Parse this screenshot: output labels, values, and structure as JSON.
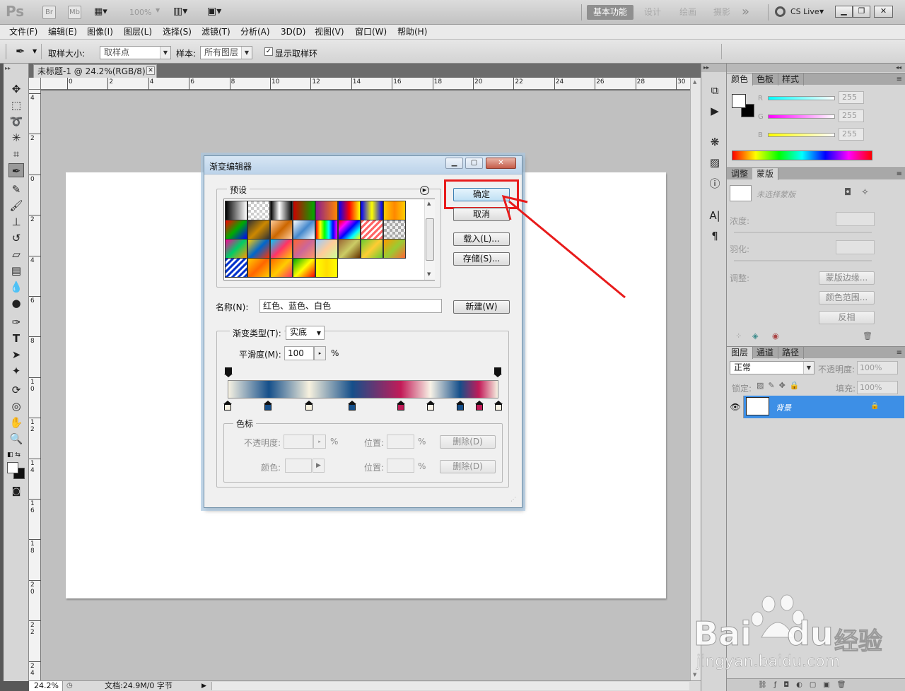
{
  "app": {
    "logo": "Ps",
    "br": "Br",
    "mb": "Mb",
    "zoom": "100%",
    "workspaces": [
      "基本功能",
      "设计",
      "绘画",
      "摄影"
    ],
    "more": "»",
    "cslive": "CS Live"
  },
  "menus": [
    "文件(F)",
    "编辑(E)",
    "图像(I)",
    "图层(L)",
    "选择(S)",
    "滤镜(T)",
    "分析(A)",
    "3D(D)",
    "视图(V)",
    "窗口(W)",
    "帮助(H)"
  ],
  "options": {
    "sample_size_label": "取样大小:",
    "sample_size_value": "取样点",
    "sample_label": "样本:",
    "sample_value": "所有图层",
    "show_ring_label": "显示取样环",
    "show_ring_checked": true
  },
  "document": {
    "tab_title": "未标题-1 @ 24.2%(RGB/8) *",
    "ruler_top": [
      "0",
      "2",
      "4",
      "6",
      "8",
      "10",
      "12",
      "14",
      "16",
      "18",
      "20",
      "22",
      "24",
      "26",
      "28",
      "30"
    ],
    "ruler_left": [
      "4",
      "2",
      "0",
      "2",
      "4",
      "6",
      "8",
      "1\n0",
      "1\n2",
      "1\n4",
      "1\n6",
      "1\n8",
      "2\n0",
      "2\n2",
      "2\n4"
    ],
    "zoom": "24.2%",
    "doc_info": "文档:24.9M/0 字节"
  },
  "color_panel": {
    "tabs": [
      "颜色",
      "色板",
      "样式"
    ],
    "r": "255",
    "g": "255",
    "b": "255",
    "r_label": "R",
    "g_label": "G",
    "b_label": "B"
  },
  "mask_panel": {
    "tabs": [
      "调整",
      "蒙版"
    ],
    "no_mask": "未选择蒙版",
    "density": "浓度:",
    "feather": "羽化:",
    "adjust": "调整:",
    "btn_edge": "蒙版边缘...",
    "btn_range": "颜色范围...",
    "btn_invert": "反相"
  },
  "layers_panel": {
    "tabs": [
      "图层",
      "通道",
      "路径"
    ],
    "mode": "正常",
    "opacity_label": "不透明度:",
    "opacity": "100%",
    "lock_label": "锁定:",
    "fill_label": "填充:",
    "fill": "100%",
    "layer_name": "背景"
  },
  "dialog": {
    "title": "渐变编辑器",
    "preset_label": "预设",
    "ok": "确定",
    "cancel": "取消",
    "load": "载入(L)...",
    "save": "存储(S)...",
    "name_label": "名称(N):",
    "name_value": "红色、蓝色、白色",
    "new": "新建(W)",
    "type_label": "渐变类型(T):",
    "type_value": "实底",
    "smooth_label": "平滑度(M):",
    "smooth_value": "100",
    "pct": "%",
    "stops_label": "色标",
    "opacity_label": "不透明度:",
    "location_label": "位置:",
    "color_label": "颜色:",
    "delete": "删除(D)",
    "swatches": [
      "linear-gradient(90deg,#000,#fff)",
      "repeating-conic-gradient(#ccc 0 25%,#fff 0 50%) 0 0/8px 8px",
      "linear-gradient(90deg,#000,#fff 40%,#000)",
      "linear-gradient(90deg,#c00,#0a0)",
      "linear-gradient(90deg,#8a1a90,#f80)",
      "linear-gradient(90deg,#00f,#f00,#ff0)",
      "linear-gradient(90deg,#00f,#ff0,#00f)",
      "linear-gradient(90deg,#fc0,#f80,#fc0)",
      "linear-gradient(135deg,#f00,#0a0,#00f)",
      "linear-gradient(135deg,#333,#c80,#333)",
      "linear-gradient(135deg,#fc9,#c60,#fc9)",
      "linear-gradient(135deg,#fff,#48c,#fff)",
      "linear-gradient(90deg,#f00,#ff0,#0f0,#0ff,#00f,#f0f)",
      "linear-gradient(135deg,#f00,#f0f,#00f,#0ff,#ff0)",
      "repeating-linear-gradient(135deg,#f66 0 3px,#fff 3px 6px)",
      "repeating-conic-gradient(#aaa 0 25%,#eee 0 50%) 0 0/8px 8px",
      "linear-gradient(135deg,#f09,#0c6,#f90)",
      "linear-gradient(135deg,#fc0,#06c,#f30)",
      "linear-gradient(135deg,#0cf,#f36,#fc0)",
      "linear-gradient(135deg,#f63,#c69,#f96)",
      "linear-gradient(135deg,#9cf,#fc9,#cf9)",
      "linear-gradient(135deg,#963,#cc6,#630)",
      "linear-gradient(135deg,#6c3,#fc3,#6c3)",
      "linear-gradient(135deg,#f90,#9c3,#f63)",
      "repeating-linear-gradient(135deg,#03c 0 3px,#fff 3px 6px)",
      "linear-gradient(135deg,#fc0,#f60,#fc0)",
      "linear-gradient(135deg,#f60,#fc0,#f36)",
      "linear-gradient(135deg,#0a0,#ff0,#f00)",
      "linear-gradient(90deg,#ff0,#fd0,#ff0)"
    ],
    "gradient": "linear-gradient(90deg,#f6f1e2 0%,#154f8a 15%,#f7f1de 30%,#154f8a 46%,#c21b58 64%,#f8f2e6 75%,#154f8a 86%,#c21b58 93%,#f6f1e2 100%)",
    "color_stops": [
      {
        "pos": 0,
        "color": "#f6f1e2"
      },
      {
        "pos": 15,
        "color": "#154f8a"
      },
      {
        "pos": 30,
        "color": "#f7f1de"
      },
      {
        "pos": 46,
        "color": "#154f8a"
      },
      {
        "pos": 64,
        "color": "#c21b58"
      },
      {
        "pos": 75,
        "color": "#f8f2e6"
      },
      {
        "pos": 86,
        "color": "#154f8a"
      },
      {
        "pos": 93,
        "color": "#c21b58"
      },
      {
        "pos": 100,
        "color": "#f6f1e2"
      }
    ]
  },
  "watermark": {
    "brand": "Bai",
    "brand2": "du",
    "brand3": "经验",
    "url": "jingyan.baidu.com"
  },
  "colors": {
    "highlight": "#e81b1b",
    "layer_selected": "#3d8fe6"
  }
}
